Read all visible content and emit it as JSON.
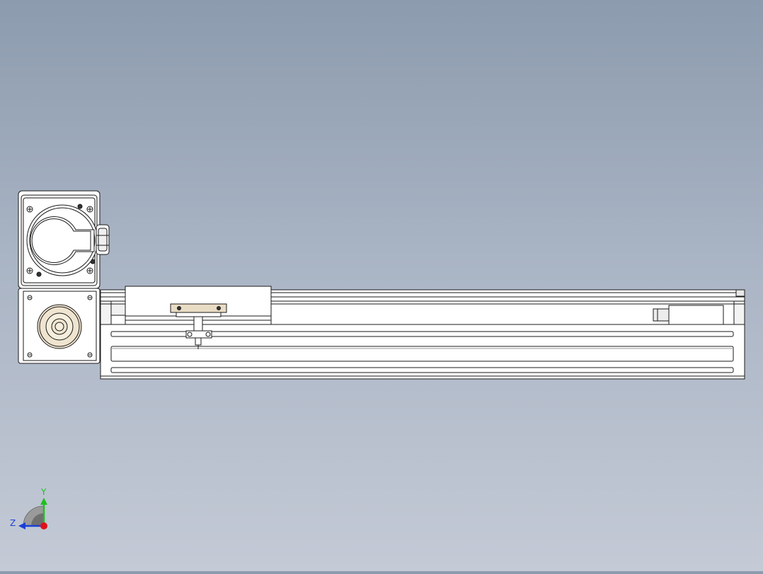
{
  "viewport": {
    "background_top": "#8c9bae",
    "background_bottom": "#c4cad6",
    "line_color": "#1a1a1a",
    "part_fill": "#ffffff",
    "carriage_plate_fill": "#e9dcc4",
    "coupling_fill": "#efe4cf"
  },
  "triad": {
    "x_axis_color": "#e0101a",
    "y_axis_color": "#1fbf1f",
    "z_axis_color": "#1a3fd8",
    "y_label": "Y",
    "z_label": "Z"
  },
  "model": {
    "components": [
      "servo-motor",
      "motor-flange",
      "coupling-housing",
      "aluminum-base-profile",
      "linear-guide-rail",
      "carriage-block",
      "sensor-bracket",
      "end-limit-block"
    ]
  }
}
